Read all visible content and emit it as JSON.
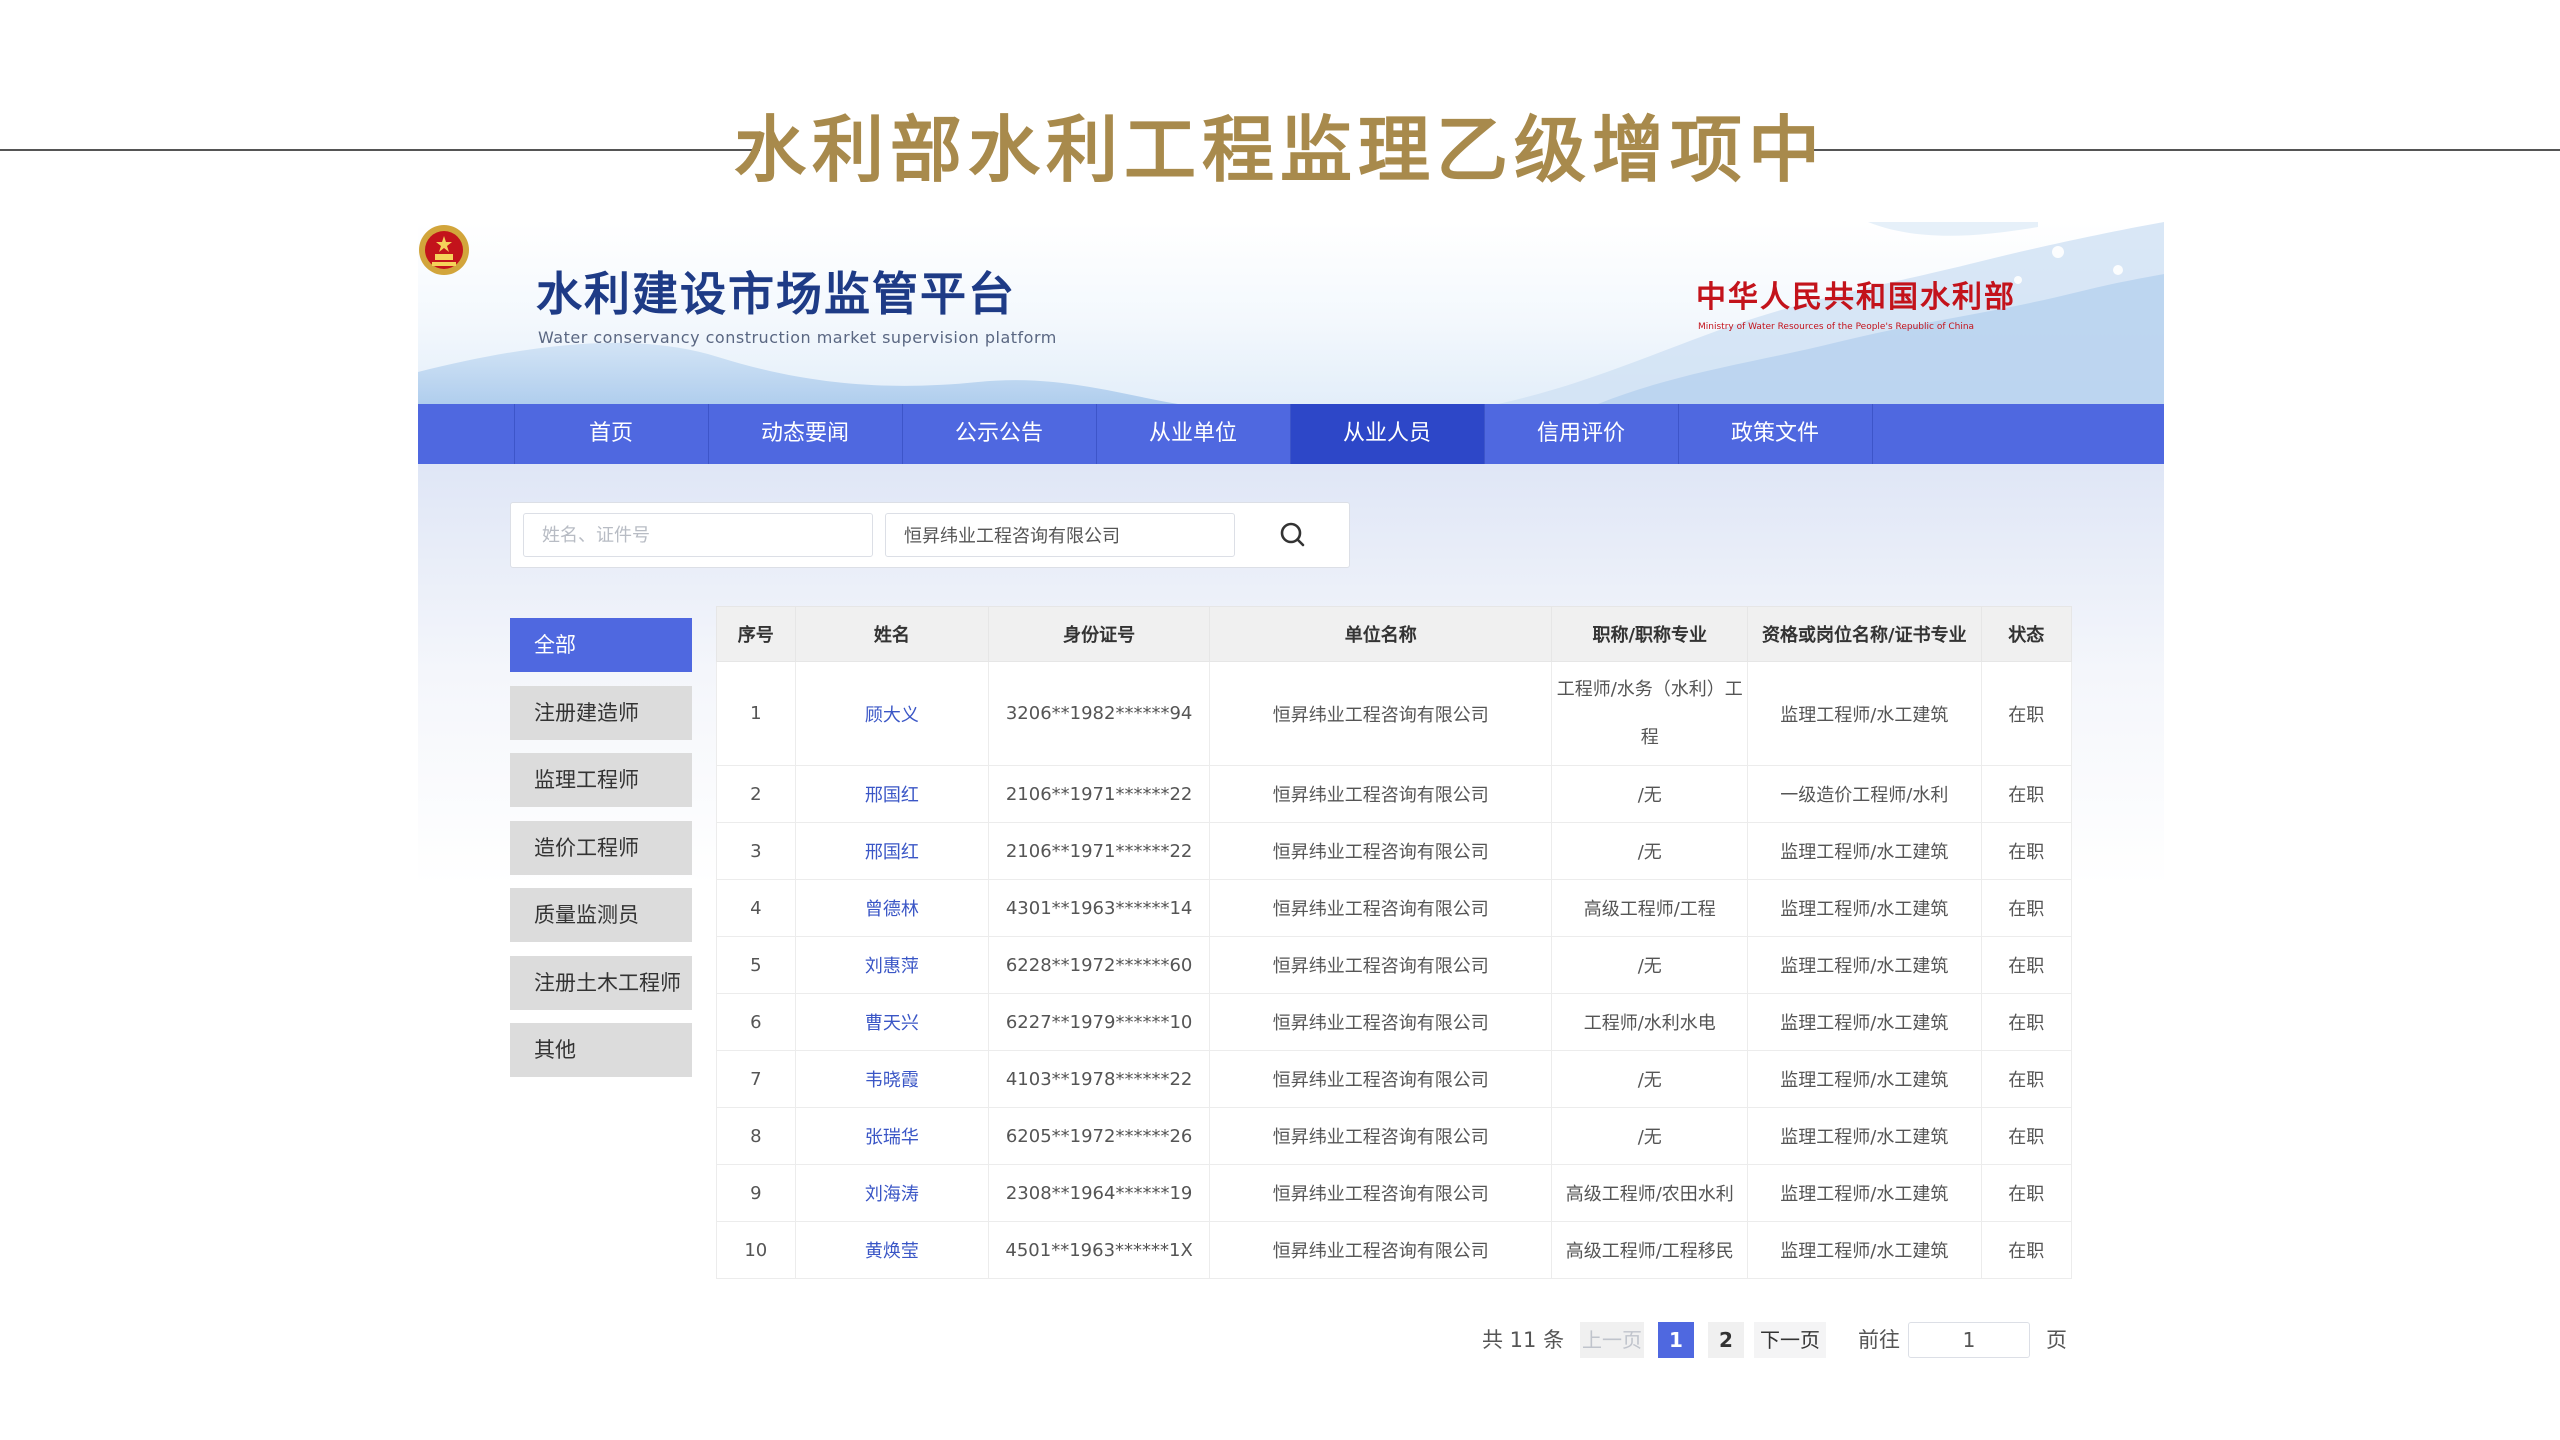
{
  "slide": {
    "title": "水利部水利工程监理乙级增项中"
  },
  "platform": {
    "title": "水利建设市场监管平台",
    "subtitle": "Water conservancy construction market supervision platform",
    "ministry_name": "中华人民共和国水利部",
    "ministry_sub": "Ministry of Water Resources of the People's Republic of China"
  },
  "nav": {
    "items": [
      "首页",
      "动态要闻",
      "公示公告",
      "从业单位",
      "从业人员",
      "信用评价",
      "政策文件"
    ],
    "active_index": 4
  },
  "search": {
    "name_placeholder": "姓名、证件号",
    "company_value": "恒昇纬业工程咨询有限公司"
  },
  "sidebar": {
    "items": [
      "全部",
      "注册建造师",
      "监理工程师",
      "造价工程师",
      "质量监测员",
      "注册土木工程师",
      "其他"
    ],
    "active_index": 0
  },
  "table": {
    "headers": [
      "序号",
      "姓名",
      "身份证号",
      "单位名称",
      "职称/职称专业",
      "资格或岗位名称/证书专业",
      "状态"
    ],
    "rows": [
      [
        "1",
        "顾大义",
        "3206**1982******94",
        "恒昇纬业工程咨询有限公司",
        "工程师/水务（水利）工程",
        "监理工程师/水工建筑",
        "在职"
      ],
      [
        "2",
        "邢国红",
        "2106**1971******22",
        "恒昇纬业工程咨询有限公司",
        "/无",
        "一级造价工程师/水利",
        "在职"
      ],
      [
        "3",
        "邢国红",
        "2106**1971******22",
        "恒昇纬业工程咨询有限公司",
        "/无",
        "监理工程师/水工建筑",
        "在职"
      ],
      [
        "4",
        "曾德林",
        "4301**1963******14",
        "恒昇纬业工程咨询有限公司",
        "高级工程师/工程",
        "监理工程师/水工建筑",
        "在职"
      ],
      [
        "5",
        "刘惠萍",
        "6228**1972******60",
        "恒昇纬业工程咨询有限公司",
        "/无",
        "监理工程师/水工建筑",
        "在职"
      ],
      [
        "6",
        "曹天兴",
        "6227**1979******10",
        "恒昇纬业工程咨询有限公司",
        "工程师/水利水电",
        "监理工程师/水工建筑",
        "在职"
      ],
      [
        "7",
        "韦晓霞",
        "4103**1978******22",
        "恒昇纬业工程咨询有限公司",
        "/无",
        "监理工程师/水工建筑",
        "在职"
      ],
      [
        "8",
        "张瑞华",
        "6205**1972******26",
        "恒昇纬业工程咨询有限公司",
        "/无",
        "监理工程师/水工建筑",
        "在职"
      ],
      [
        "9",
        "刘海涛",
        "2308**1964******19",
        "恒昇纬业工程咨询有限公司",
        "高级工程师/农田水利",
        "监理工程师/水工建筑",
        "在职"
      ],
      [
        "10",
        "黄焕莹",
        "4501**1963******1X",
        "恒昇纬业工程咨询有限公司",
        "高级工程师/工程移民",
        "监理工程师/水工建筑",
        "在职"
      ]
    ]
  },
  "pagination": {
    "total": "共 11 条",
    "prev": "上一页",
    "pages": [
      "1",
      "2"
    ],
    "current": "1",
    "next": "下一页",
    "goto_label": "前往",
    "goto_value": "1",
    "page_suffix": "页"
  },
  "colors": {
    "accent": "#4f68e0",
    "title_gold": "#a88a4c",
    "ministry_red": "#c3131b"
  },
  "icons": {
    "search": "search-icon",
    "emblem": "national-emblem-icon"
  }
}
